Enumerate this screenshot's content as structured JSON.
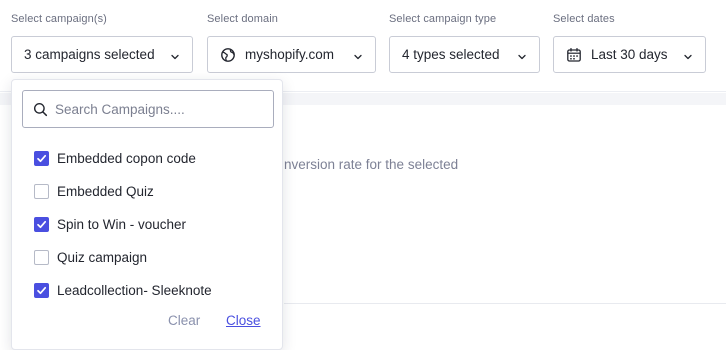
{
  "filters": {
    "campaign": {
      "label": "Select campaign(s)",
      "value": "3 campaigns selected"
    },
    "domain": {
      "label": "Select domain",
      "value": "myshopify.com",
      "icon": "globe-icon"
    },
    "campaign_type": {
      "label": "Select campaign type",
      "value": "4 types selected"
    },
    "dates": {
      "label": "Select dates",
      "value": "Last 30 days",
      "icon": "calendar-icon"
    }
  },
  "content": {
    "description_fragment": "nversion rate for the selected"
  },
  "dropdown": {
    "search_placeholder": "Search Campaigns....",
    "items": [
      {
        "label": "Embedded copon code",
        "checked": true
      },
      {
        "label": "Embedded Quiz",
        "checked": false
      },
      {
        "label": "Spin to Win - voucher",
        "checked": true
      },
      {
        "label": "Quiz campaign",
        "checked": false
      },
      {
        "label": "Leadcollection- Sleeknote",
        "checked": true
      }
    ],
    "clear_label": "Clear",
    "close_label": "Close"
  },
  "colors": {
    "accent": "#4a4fe0",
    "border": "#c9ccd6",
    "muted_text": "#7d8195"
  }
}
